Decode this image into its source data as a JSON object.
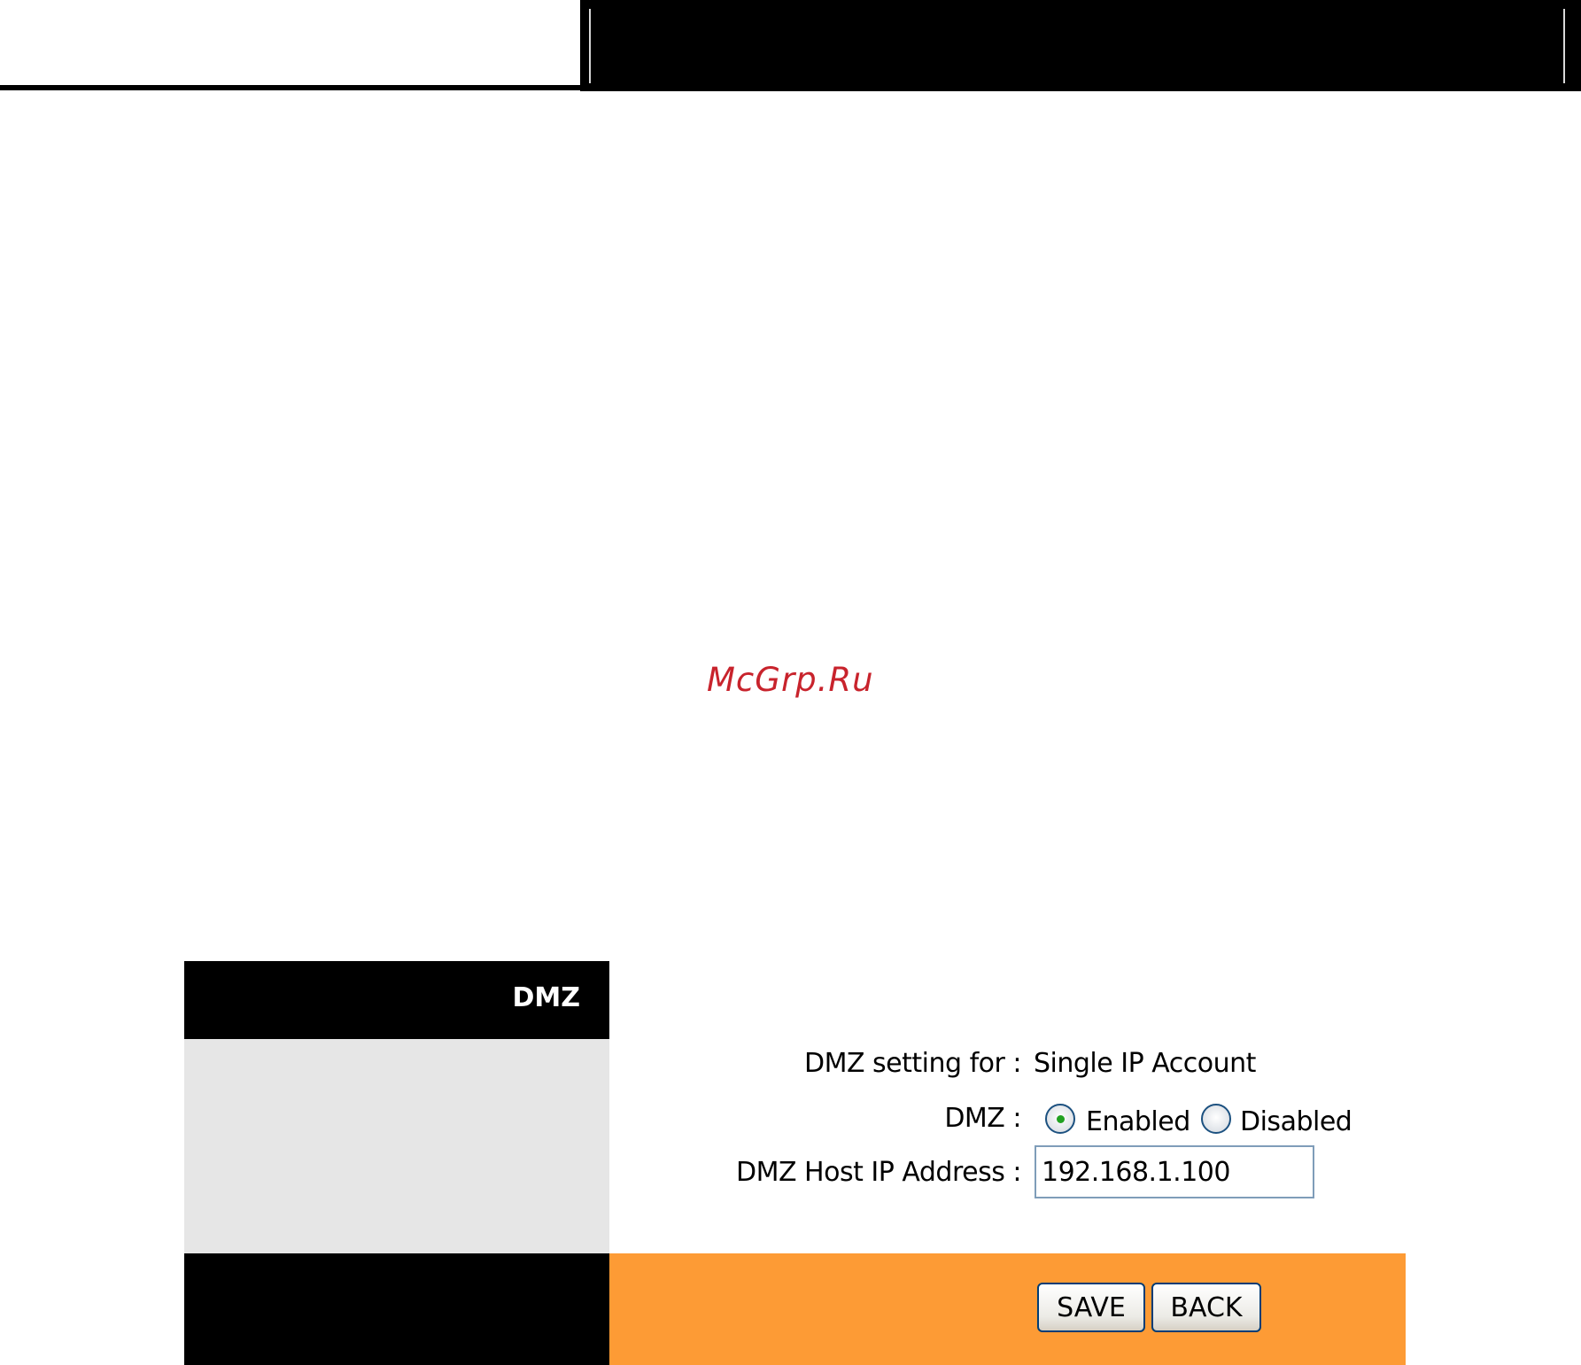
{
  "watermark": "McGrp.Ru",
  "panel": {
    "section_title": "DMZ"
  },
  "form": {
    "setting_label": "DMZ setting for :",
    "setting_value": "Single IP Account",
    "dmz_label": "DMZ :",
    "options": [
      {
        "label": "Enabled",
        "selected": true
      },
      {
        "label": "Disabled",
        "selected": false
      }
    ],
    "host_ip_label": "DMZ Host IP Address :",
    "host_ip_value": "192.168.1.100"
  },
  "buttons": {
    "save": "SAVE",
    "back": "BACK"
  },
  "colors": {
    "header": "#000000",
    "sidebar": "#e6e6e6",
    "footer_bar": "#fd9b35",
    "watermark": "#c8232c",
    "radio_selected": "#21a121"
  }
}
